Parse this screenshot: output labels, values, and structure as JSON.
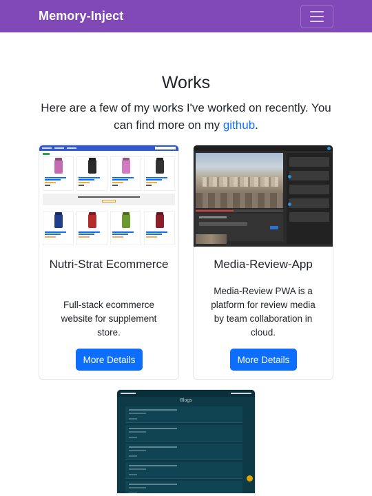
{
  "navbar": {
    "brand": "Memory-Inject",
    "toggler_icon": "hamburger-icon"
  },
  "works": {
    "title": "Works",
    "subtitle_before": "Here are a few of my works I've worked on recently. You can find more on my ",
    "subtitle_link": "github",
    "subtitle_after": "."
  },
  "projects": [
    {
      "title": "Nutri-Strat Ecommerce",
      "description": "Full-stack ecommerce website for supplement store.",
      "button": "More Details"
    },
    {
      "title": "Media-Review-App",
      "description": "Media-Review PWA is a platform for review media by team collaboration in cloud.",
      "button": "More Details"
    },
    {
      "screenshot_title": "Blogs"
    }
  ],
  "colors": {
    "navbar": "#8149b8",
    "primary_button": "#0d6efd",
    "link": "#0d6efd"
  }
}
